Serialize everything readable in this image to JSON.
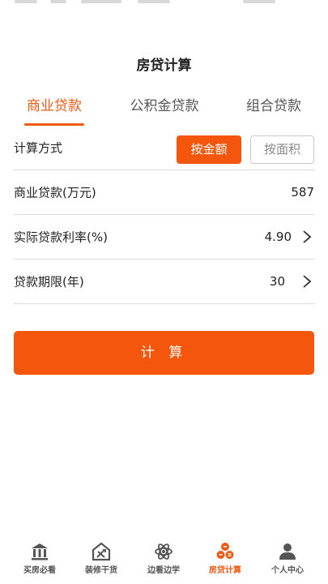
{
  "header": {
    "title": "房贷计算"
  },
  "tabs": [
    {
      "label": "商业贷款",
      "active": true
    },
    {
      "label": "公积金贷款",
      "active": false
    },
    {
      "label": "组合贷款",
      "active": false
    }
  ],
  "form": {
    "method": {
      "label": "计算方式",
      "option_amount": "按金额",
      "option_area": "按面积",
      "selected": "按金额"
    },
    "loan_amount": {
      "label": "商业贷款(万元)",
      "value": "587"
    },
    "rate": {
      "label": "实际贷款利率(%)",
      "value": "4.90"
    },
    "term": {
      "label": "贷款期限(年)",
      "value": "30"
    }
  },
  "calculate_label": "计 算",
  "bottom_nav": [
    {
      "label": "买房必看",
      "icon": "bank-icon",
      "active": false
    },
    {
      "label": "装修干货",
      "icon": "house-tools-icon",
      "active": false
    },
    {
      "label": "边看边学",
      "icon": "atom-icon",
      "active": false
    },
    {
      "label": "房贷计算",
      "icon": "coins-icon",
      "active": true
    },
    {
      "label": "个人中心",
      "icon": "person-icon",
      "active": false
    }
  ],
  "colors": {
    "accent": "#f5560d",
    "accent_text": "#f05a12",
    "divider": "#dcdcdc",
    "icon_gray": "#555555"
  }
}
